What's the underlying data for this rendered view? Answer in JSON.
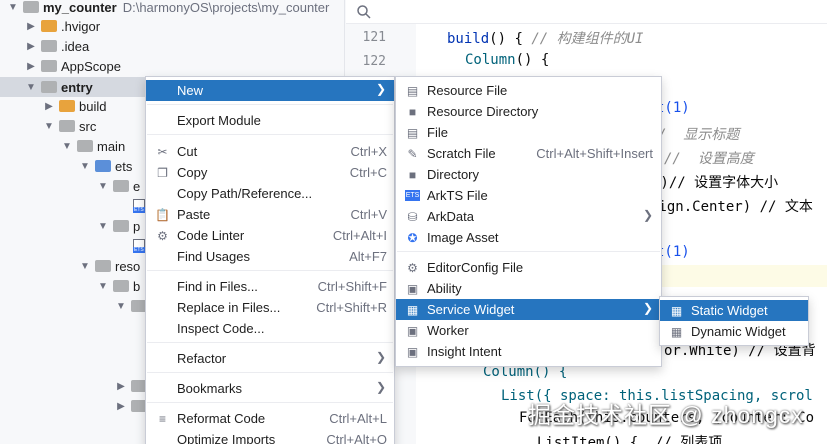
{
  "tree": {
    "root": {
      "name": "my_counter",
      "path": "D:\\harmonyOS\\projects\\my_counter"
    },
    "items": [
      {
        "label": ".hvigor"
      },
      {
        "label": ".idea"
      },
      {
        "label": "AppScope"
      },
      {
        "label": "entry"
      },
      {
        "label": "build"
      },
      {
        "label": "src"
      },
      {
        "label": "main"
      },
      {
        "label": "ets"
      },
      {
        "label": "e"
      },
      {
        "label": "p"
      },
      {
        "label": "reso"
      },
      {
        "label": "b"
      }
    ]
  },
  "editor": {
    "line_numbers": [
      "121",
      "122"
    ],
    "lines": [
      {
        "kw": "build",
        "rest": "() { ",
        "comment": "// 构建组件的UI"
      },
      {
        "kw": "Column",
        "rest": "() {",
        "comment": ""
      }
    ],
    "fragments": {
      "f1": "t(1)",
      "f2": "/  显示标题",
      "f3": "//  设置高度",
      "f4": "')// 设置字体大小",
      "f5": "lign.Center) // 文本",
      "f6": "t(1)",
      "f7": "or.White) // 设置背",
      "column": "Column() {",
      "list": "List({ space: this.listSpacing, scrol",
      "foreach": "ForEach(this.counters, (counter: Co",
      "listitem": "ListItem() {  // 列表项"
    }
  },
  "context_menu": {
    "items": [
      {
        "label": "New",
        "shortcut": ""
      },
      {
        "label": "Export Module",
        "shortcut": ""
      },
      {
        "label": "Cut",
        "shortcut": "Ctrl+X"
      },
      {
        "label": "Copy",
        "shortcut": "Ctrl+C"
      },
      {
        "label": "Copy Path/Reference...",
        "shortcut": ""
      },
      {
        "label": "Paste",
        "shortcut": "Ctrl+V"
      },
      {
        "label": "Code Linter",
        "shortcut": "Ctrl+Alt+I"
      },
      {
        "label": "Find Usages",
        "shortcut": "Alt+F7"
      },
      {
        "label": "Find in Files...",
        "shortcut": "Ctrl+Shift+F"
      },
      {
        "label": "Replace in Files...",
        "shortcut": "Ctrl+Shift+R"
      },
      {
        "label": "Inspect Code...",
        "shortcut": ""
      },
      {
        "label": "Refactor",
        "shortcut": ""
      },
      {
        "label": "Bookmarks",
        "shortcut": ""
      },
      {
        "label": "Reformat Code",
        "shortcut": "Ctrl+Alt+L"
      },
      {
        "label": "Optimize Imports",
        "shortcut": "Ctrl+Alt+O"
      }
    ]
  },
  "new_menu": {
    "items": [
      {
        "label": "Resource File",
        "shortcut": ""
      },
      {
        "label": "Resource Directory",
        "shortcut": ""
      },
      {
        "label": "File",
        "shortcut": ""
      },
      {
        "label": "Scratch File",
        "shortcut": "Ctrl+Alt+Shift+Insert"
      },
      {
        "label": "Directory",
        "shortcut": ""
      },
      {
        "label": "ArkTS File",
        "shortcut": ""
      },
      {
        "label": "ArkData",
        "shortcut": ""
      },
      {
        "label": "Image Asset",
        "shortcut": ""
      },
      {
        "label": "EditorConfig File",
        "shortcut": ""
      },
      {
        "label": "Ability",
        "shortcut": ""
      },
      {
        "label": "Service Widget",
        "shortcut": ""
      },
      {
        "label": "Worker",
        "shortcut": ""
      },
      {
        "label": "Insight Intent",
        "shortcut": ""
      }
    ]
  },
  "widget_menu": {
    "items": [
      {
        "label": "Static Widget"
      },
      {
        "label": "Dynamic Widget"
      }
    ]
  },
  "watermark": "掘金技术社区 @ zhongcx",
  "colors": {
    "selection": "#2675bf",
    "folder_orange": "#e8a33d",
    "folder_blue": "#5b8fd9"
  }
}
